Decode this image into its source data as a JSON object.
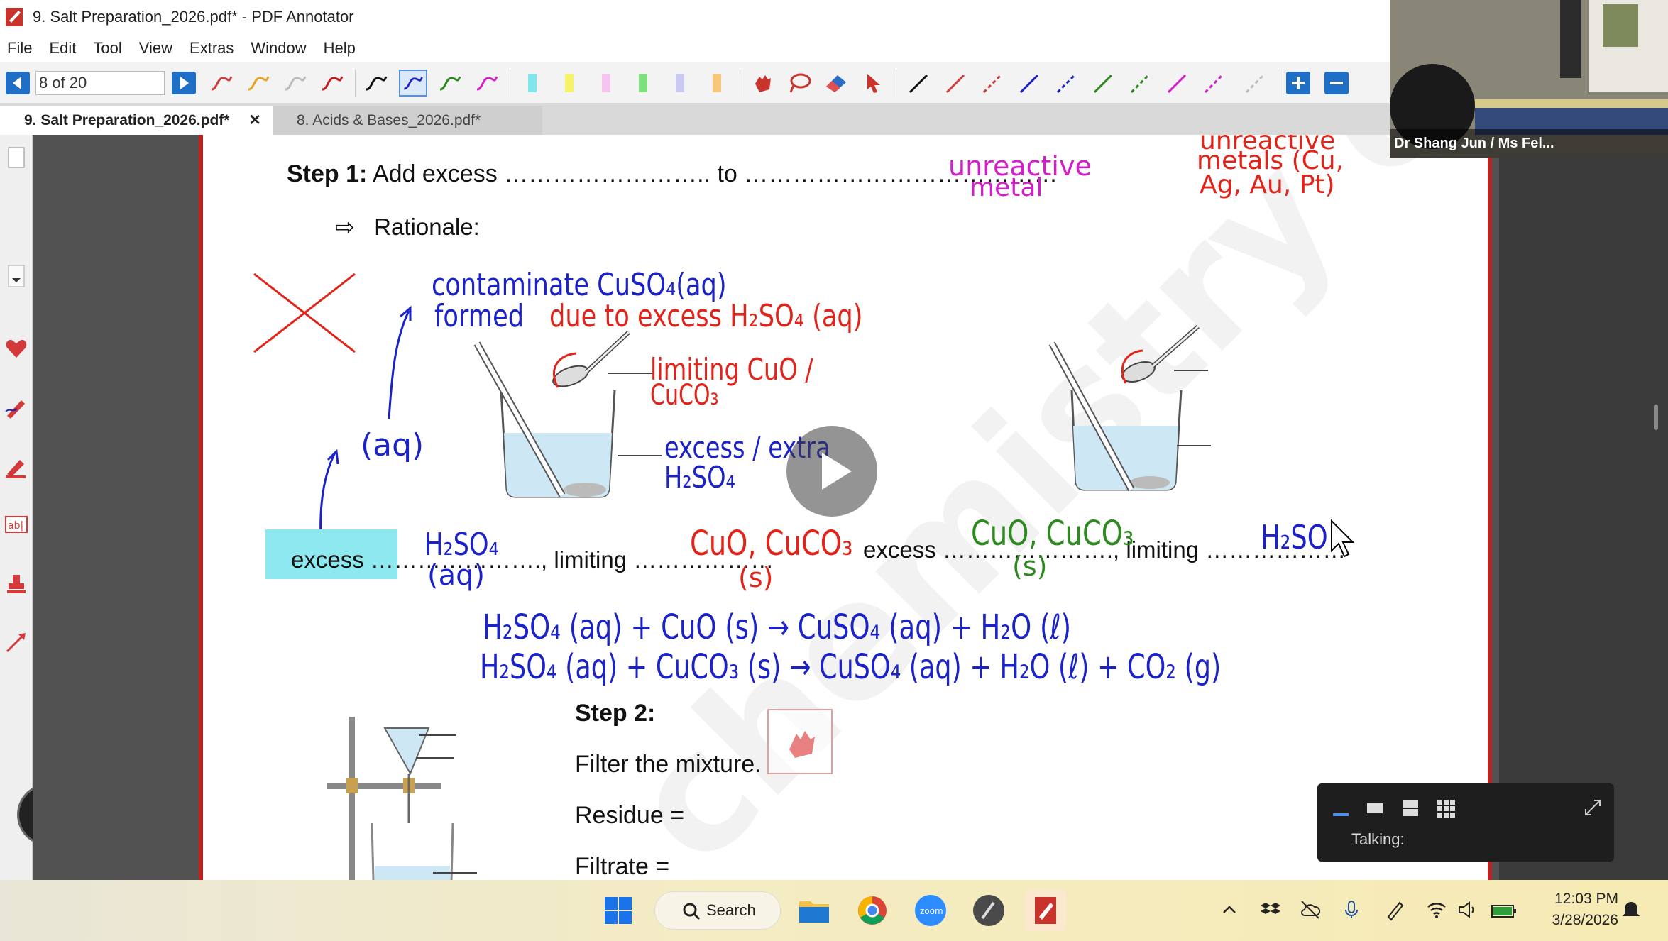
{
  "window": {
    "title": "9. Salt Preparation_2026.pdf* - PDF Annotator"
  },
  "menu": [
    "File",
    "Edit",
    "Tool",
    "View",
    "Extras",
    "Window",
    "Help"
  ],
  "toolbar": {
    "page_indicator": "8 of 20"
  },
  "tabs": [
    {
      "label": "9. Salt Preparation_2026.pdf*",
      "close": "✕",
      "active": true
    },
    {
      "label": "8. Acids & Bases_2026.pdf*",
      "active": false
    }
  ],
  "document": {
    "step1_label": "Step 1:",
    "step1_text": "Add excess …………………….. to …………………………………",
    "rationale": "Rationale:",
    "excess_line_1": "excess …………………., limiting ………………",
    "excess_line_2": "excess …………………., limiting ………………",
    "step2_label": "Step 2:",
    "filter_text": "Filter the mixture.",
    "residue_text": "Residue =",
    "filtrate_text": "Filtrate ="
  },
  "annotations": {
    "unreactive": "unreactive",
    "metal": "metal",
    "unreactive_metals": "unreactive",
    "metals_list": "metals (Cu,",
    "metals_list2": "Ag, Au, Pt)",
    "contaminate": "contaminate CuSO₄(aq)",
    "formed": "formed",
    "due_to_excess": "due to excess H₂SO₄ (aq)",
    "limiting_cuo": "limiting CuO /",
    "cuco3": "CuCO₃",
    "excess_extra": "excess / extra",
    "h2so4_label": "H₂SO₄",
    "aq_label": "(aq)",
    "h2so4_blank": "H₂SO₄",
    "aq_blank": "(aq)",
    "cuo_cuco3_red": "CuO, CuCO₃",
    "s_red": "(s)",
    "cuo_cuco3_green": "CuO, CuCO₃",
    "s_green": "(s)",
    "h2so4_limiting": "H₂SO",
    "eq1": "H₂SO₄ (aq) + CuO (s) → CuSO₄ (aq) + H₂O (ℓ)",
    "eq2": "H₂SO₄ (aq) + CuCO₃ (s) → CuSO₄ (aq) + H₂O (ℓ) + CO₂ (g)"
  },
  "video": {
    "participant_name": "Dr Shang Jun / Ms Fel..."
  },
  "zoom_panel": {
    "status": "Talking:"
  },
  "taskbar": {
    "search_label": "Search",
    "time": "12:03 PM",
    "date": "3/28/2026"
  },
  "colors": {
    "ink_blue": "#1a22c8",
    "ink_red": "#e2231a",
    "ink_green": "#2d8a1e",
    "ink_magenta": "#d21fc8",
    "highlight_cyan": "#8ee8f0",
    "nav_blue": "#1f6fc6"
  }
}
